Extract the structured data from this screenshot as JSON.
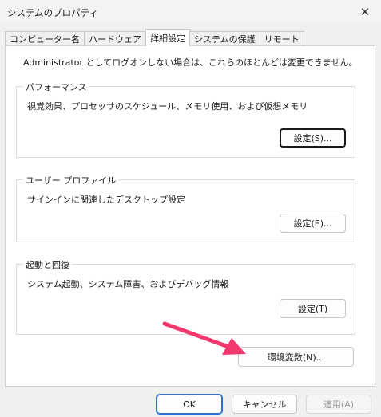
{
  "window": {
    "title": "システムのプロパティ",
    "close_glyph": "✕"
  },
  "tabs": [
    {
      "label": "コンピューター名",
      "active": false
    },
    {
      "label": "ハードウェア",
      "active": false
    },
    {
      "label": "詳細設定",
      "active": true
    },
    {
      "label": "システムの保護",
      "active": false
    },
    {
      "label": "リモート",
      "active": false
    }
  ],
  "advanced": {
    "admin_note": "Administrator としてログオンしない場合は、これらのほとんどは変更できません。",
    "performance": {
      "label": "パフォーマンス",
      "description": "視覚効果、プロセッサのスケジュール、メモリ使用、および仮想メモリ",
      "button": "設定(S)..."
    },
    "user_profile": {
      "label": "ユーザー プロファイル",
      "description": "サインインに関連したデスクトップ設定",
      "button": "設定(E)..."
    },
    "startup_recovery": {
      "label": "起動と回復",
      "description": "システム起動、システム障害、およびデバッグ情報",
      "button": "設定(T)"
    },
    "env_vars_button": "環境変数(N)..."
  },
  "footer": {
    "ok": "OK",
    "cancel": "キャンセル",
    "apply": "適用(A)"
  },
  "colors": {
    "annotation_arrow": "#f2386c",
    "primary_border": "#2b6fd6"
  },
  "icons": {
    "close": "close-icon",
    "arrow": "annotation-arrow"
  }
}
